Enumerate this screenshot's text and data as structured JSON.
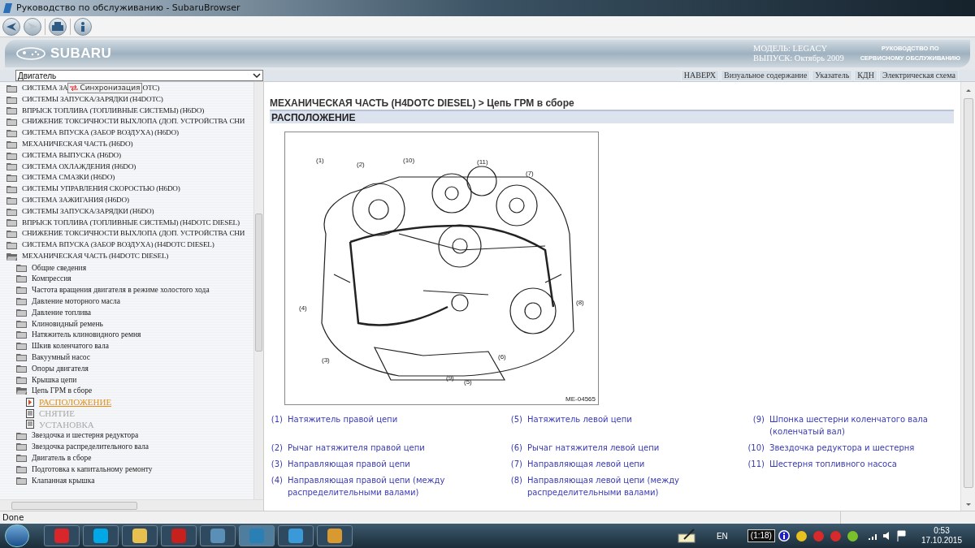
{
  "window": {
    "title": "Руководство по обслуживанию - SubaruBrowser"
  },
  "header": {
    "brand": "SUBARU",
    "model": "МОДЕЛЬ: LEGACY",
    "issue": "ВЫПУСК: Октябрь 2009",
    "manual_line1": "РУКОВОДСТВО ПО",
    "manual_line2": "СЕРВИСНОМУ ОБСЛУЖИВАНИЮ"
  },
  "section_select": {
    "value": "Двигатель"
  },
  "nav_links": [
    "НАВЕРХ",
    "Визуальное содержание",
    "Указатель",
    "КДН",
    "Электрическая схема"
  ],
  "tree": {
    "tooltip": "Синхронизация",
    "items": [
      {
        "kind": "folder",
        "label": "СИСТЕМА ЗА",
        "label_after": "ОТС)",
        "expanded": false
      },
      {
        "kind": "folder",
        "label": "СИСТЕМЫ ЗАПУСКА/ЗАРЯДКИ (H4DOTC)",
        "expanded": false
      },
      {
        "kind": "folder",
        "label": "ВПРЫСК ТОПЛИВА (ТОПЛИВНЫЕ СИСТЕМЫ) (H6DO)",
        "expanded": false
      },
      {
        "kind": "folder",
        "label": "СНИЖЕНИЕ ТОКСИЧНОСТИ ВЫХЛОПА (ДОП. УСТРОЙСТВА СНИ",
        "expanded": false
      },
      {
        "kind": "folder",
        "label": "СИСТЕМА ВПУСКА (ЗАБОР ВОЗДУХА) (H6DO)",
        "expanded": false
      },
      {
        "kind": "folder",
        "label": "МЕХАНИЧЕСКАЯ ЧАСТЬ (H6DO)",
        "expanded": false
      },
      {
        "kind": "folder",
        "label": "СИСТЕМА ВЫПУСКА (H6DO)",
        "expanded": false
      },
      {
        "kind": "folder",
        "label": "СИСТЕМА ОХЛАЖДЕНИЯ (H6DO)",
        "expanded": false
      },
      {
        "kind": "folder",
        "label": "СИСТЕМА СМАЗКИ (H6DO)",
        "expanded": false
      },
      {
        "kind": "folder",
        "label": "СИСТЕМЫ УПРАВЛЕНИЯ СКОРОСТЬЮ (H6DO)",
        "expanded": false
      },
      {
        "kind": "folder",
        "label": "СИСТЕМА ЗАЖИГАНИЯ (H6DO)",
        "expanded": false
      },
      {
        "kind": "folder",
        "label": "СИСТЕМЫ ЗАПУСКА/ЗАРЯДКИ (H6DO)",
        "expanded": false
      },
      {
        "kind": "folder",
        "label": "ВПРЫСК ТОПЛИВА (ТОПЛИВНЫЕ СИСТЕМЫ) (H4DOTC DIESEL)",
        "expanded": false
      },
      {
        "kind": "folder",
        "label": "СНИЖЕНИЕ ТОКСИЧНОСТИ ВЫХЛОПА (ДОП. УСТРОЙСТВА СНИ",
        "expanded": false
      },
      {
        "kind": "folder",
        "label": "СИСТЕМА ВПУСКА (ЗАБОР ВОЗДУХА) (H4DOTC DIESEL)",
        "expanded": false
      },
      {
        "kind": "folder",
        "label": "МЕХАНИЧЕСКАЯ ЧАСТЬ (H4DOTC DIESEL)",
        "expanded": true,
        "children": [
          {
            "kind": "folder",
            "label": "Общие сведения",
            "expanded": false
          },
          {
            "kind": "folder",
            "label": "Компрессия",
            "expanded": false
          },
          {
            "kind": "folder",
            "label": "Частота вращения двигателя в режиме холостого хода",
            "expanded": false
          },
          {
            "kind": "folder",
            "label": "Давление моторного масла",
            "expanded": false
          },
          {
            "kind": "folder",
            "label": "Давление топлива",
            "expanded": false
          },
          {
            "kind": "folder",
            "label": "Клиновидный ремень",
            "expanded": false
          },
          {
            "kind": "folder",
            "label": "Натяжитель клиновидного ремня",
            "expanded": false
          },
          {
            "kind": "folder",
            "label": "Шкив коленчатого вала",
            "expanded": false
          },
          {
            "kind": "folder",
            "label": "Вакуумный насос",
            "expanded": false
          },
          {
            "kind": "folder",
            "label": "Опоры двигателя",
            "expanded": false
          },
          {
            "kind": "folder",
            "label": "Крышка цепи",
            "expanded": false
          },
          {
            "kind": "folder",
            "label": "Цепь ГРМ в сборе",
            "expanded": true,
            "children": [
              {
                "kind": "doc",
                "label": "РАСПОЛОЖЕНИЕ",
                "selected": true
              },
              {
                "kind": "doc",
                "label": "СНЯТИЕ",
                "selected": false
              },
              {
                "kind": "doc",
                "label": "УСТАНОВКА",
                "selected": false
              }
            ]
          },
          {
            "kind": "folder",
            "label": "Звездочка и шестерня редуктора",
            "expanded": false
          },
          {
            "kind": "folder",
            "label": "Звездочка распределительного вала",
            "expanded": false
          },
          {
            "kind": "folder",
            "label": "Двигатель в сборе",
            "expanded": false
          },
          {
            "kind": "folder",
            "label": "Подготовка к капитальному ремонту",
            "expanded": false
          },
          {
            "kind": "folder",
            "label": "Клапанная крышка",
            "expanded": false
          }
        ]
      }
    ]
  },
  "content": {
    "breadcrumb": "МЕХАНИЧЕСКАЯ ЧАСТЬ (H4DOTC DIESEL) > Цепь ГРМ в сборе",
    "section": "РАСПОЛОЖЕНИЕ",
    "figure": {
      "callouts": [
        "(1)",
        "(2)",
        "(10)",
        "(11)",
        "(7)",
        "(4)",
        "(8)",
        "(3)",
        "(9)",
        "(5)",
        "(6)"
      ],
      "code": "ME-04565"
    },
    "legend_columns": [
      [
        {
          "num": "(1)",
          "text": "Натяжитель правой цепи"
        },
        {
          "num": "(2)",
          "text": "Рычаг натяжителя правой цепи"
        },
        {
          "num": "(3)",
          "text": "Направляющая правой цепи"
        },
        {
          "num": "(4)",
          "text": "Направляющая правой цепи (между распределительными валами)"
        }
      ],
      [
        {
          "num": "(5)",
          "text": "Натяжитель левой цепи"
        },
        {
          "num": "(6)",
          "text": "Рычаг натяжителя левой цепи"
        },
        {
          "num": "(7)",
          "text": "Направляющая левой цепи"
        },
        {
          "num": "(8)",
          "text": "Направляющая левой цепи (между распределительными валами)"
        }
      ],
      [
        {
          "num": "(9)",
          "text": "Шпонка шестерни коленчатого вала (коленчатый вал)"
        },
        {
          "num": "(10)",
          "text": "Звездочка редуктора и шестерня"
        },
        {
          "num": "(11)",
          "text": "Шестерня топливного насоса"
        }
      ]
    ]
  },
  "status_bar": {
    "text": "Done"
  },
  "taskbar": {
    "language": "EN",
    "battery": "(1:18)",
    "time": "0:53",
    "date": "17.10.2015"
  }
}
